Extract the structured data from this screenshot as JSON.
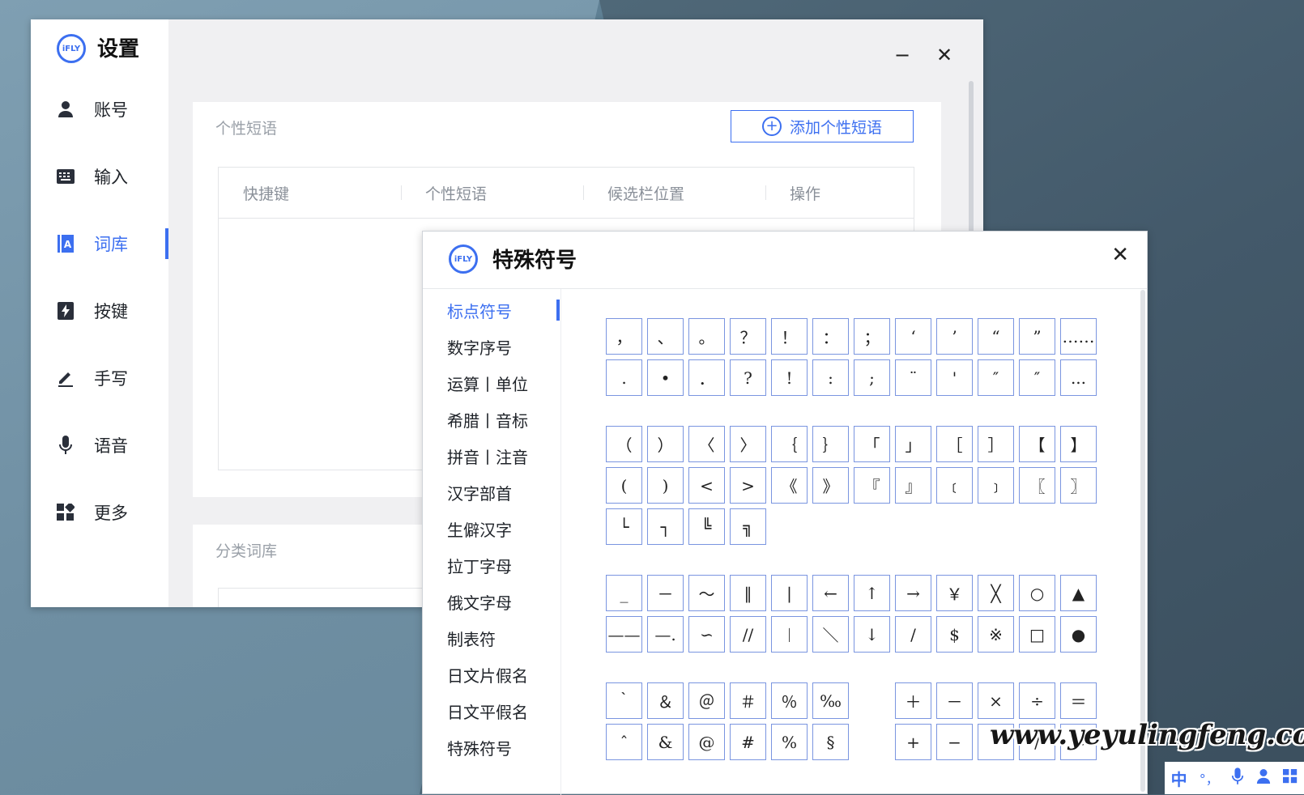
{
  "settings": {
    "logo": "iFLY",
    "title": "设置",
    "nav": [
      {
        "label": "账号",
        "icon": "user-icon"
      },
      {
        "label": "输入",
        "icon": "keyboard-icon"
      },
      {
        "label": "词库",
        "icon": "dictionary-icon",
        "active": true
      },
      {
        "label": "按键",
        "icon": "lightning-key-icon"
      },
      {
        "label": "手写",
        "icon": "pen-icon"
      },
      {
        "label": "语音",
        "icon": "microphone-icon"
      },
      {
        "label": "更多",
        "icon": "apps-grid-icon"
      }
    ],
    "window_minimize": "−",
    "window_close": "✕",
    "panel_title": "个性短语",
    "add_button": "添加个性短语",
    "table_headers": [
      "快捷键",
      "个性短语",
      "候选栏位置",
      "操作"
    ],
    "panel2_title": "分类词库"
  },
  "symbols": {
    "logo": "iFLY",
    "title": "特殊符号",
    "close": "✕",
    "categories": [
      "标点符号",
      "数字序号",
      "运算丨单位",
      "希腊丨音标",
      "拼音丨注音",
      "汉字部首",
      "生僻汉字",
      "拉丁字母",
      "俄文字母",
      "制表符",
      "日文片假名",
      "日文平假名",
      "特殊符号"
    ],
    "active_category": "标点符号",
    "groups": [
      {
        "rows": [
          [
            "，",
            "、",
            "。",
            "？",
            "！",
            "：",
            "；",
            "‘",
            "’",
            "“",
            "”",
            "……"
          ],
          [
            ".",
            "•",
            "．",
            "?",
            "!",
            ":",
            ";",
            "¨",
            "'",
            "″",
            "″",
            "..."
          ]
        ]
      },
      {
        "rows": [
          [
            "（",
            "）",
            "〈",
            "〉",
            "｛",
            "｝",
            "「",
            "」",
            "［",
            "］",
            "【",
            "】"
          ],
          [
            "(",
            ")",
            "<",
            ">",
            "《",
            "》",
            "『",
            "』",
            "﹝",
            "﹞",
            "〖",
            "〗"
          ],
          [
            "└",
            "┐",
            "╚",
            "╗"
          ]
        ]
      },
      {
        "rows": [
          [
            "_",
            "－",
            "～",
            "‖",
            "|",
            "←",
            "↑",
            "→",
            "￥",
            "╳",
            "○",
            "▲"
          ],
          [
            "——",
            "—.",
            "∽",
            "//",
            "︱",
            "＼",
            "↓",
            "/",
            "$",
            "※",
            "□",
            "●"
          ]
        ]
      },
      {
        "rows": [
          [
            "｀",
            "＆",
            "＠",
            "＃",
            "％",
            "‰",
            "",
            "＋",
            "－",
            "×",
            "÷",
            "＝"
          ],
          [
            "ˆ",
            "&",
            "@",
            "#",
            "%",
            "§",
            "",
            "+",
            "−",
            "*",
            "/",
            "="
          ]
        ]
      }
    ]
  },
  "watermark": "www.yeyulingfeng.com",
  "tray": [
    "中",
    "°，",
    "mic",
    "user",
    "apps"
  ],
  "colors": {
    "accent": "#3c6ff0"
  }
}
